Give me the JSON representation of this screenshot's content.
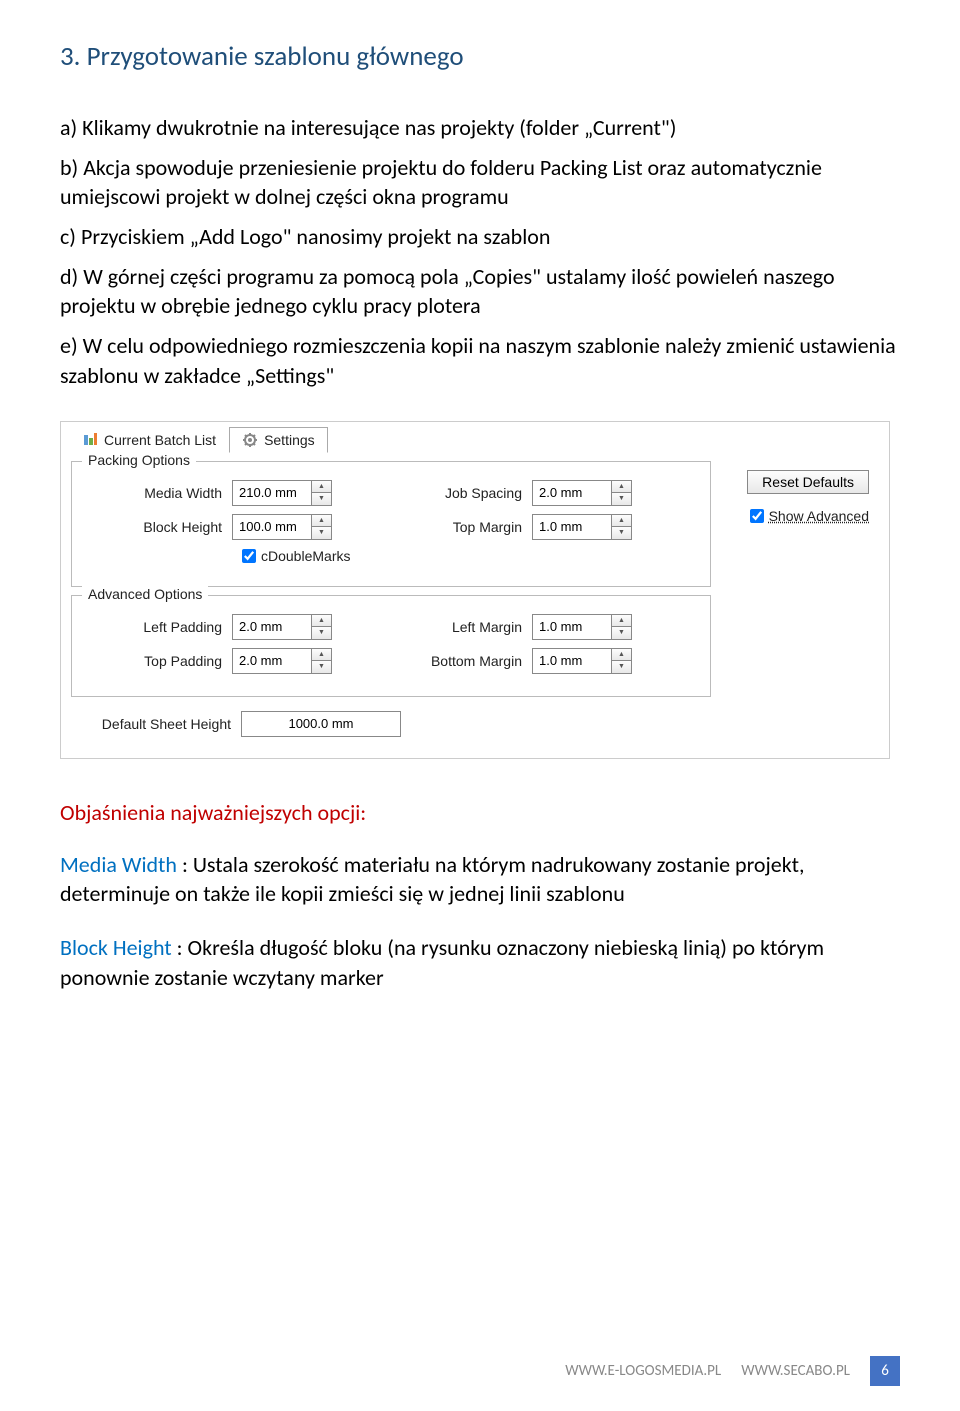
{
  "heading": "3. Przygotowanie szablonu głównego",
  "body": {
    "a": "a) Klikamy dwukrotnie na interesujące nas projekty (folder „Current\")",
    "b": "b) Akcja spowoduje przeniesienie projektu do folderu Packing List oraz automatycznie umiejscowi projekt w dolnej części okna programu",
    "c": "c) Przyciskiem „Add Logo\" nanosimy projekt na szablon",
    "d": "d) W górnej części programu za pomocą pola „Copies\" ustalamy ilość powieleń naszego projektu w obrębie jednego cyklu pracy plotera",
    "e": "e) W celu odpowiedniego rozmieszczenia kopii na naszym szablonie należy zmienić ustawienia szablonu w zakładce „Settings\""
  },
  "tabs": {
    "current": "Current Batch List",
    "settings": "Settings"
  },
  "packing": {
    "legend": "Packing Options",
    "mediaWidthLabel": "Media Width",
    "mediaWidthValue": "210.0 mm",
    "blockHeightLabel": "Block Height",
    "blockHeightValue": "100.0 mm",
    "jobSpacingLabel": "Job Spacing",
    "jobSpacingValue": "2.0 mm",
    "topMarginLabel": "Top Margin",
    "topMarginValue": "1.0 mm",
    "doubleMarks": "cDoubleMarks"
  },
  "advanced": {
    "legend": "Advanced Options",
    "leftPaddingLabel": "Left Padding",
    "leftPaddingValue": "2.0 mm",
    "topPaddingLabel": "Top Padding",
    "topPaddingValue": "2.0 mm",
    "leftMarginLabel": "Left Margin",
    "leftMarginValue": "1.0 mm",
    "bottomMarginLabel": "Bottom Margin",
    "bottomMarginValue": "1.0 mm"
  },
  "sheet": {
    "label": "Default Sheet Height",
    "value": "1000.0 mm"
  },
  "side": {
    "reset": "Reset Defaults",
    "showAdvanced": "Show Advanced"
  },
  "explain": {
    "heading": "Objaśnienia najważniejszych opcji:",
    "mediaWidthTerm": "Media Width",
    "mediaWidthText": " : Ustala szerokość materiału na którym nadrukowany zostanie projekt, determinuje on także ile kopii zmieści się w jednej linii szablonu",
    "blockHeightTerm": "Block Height",
    "blockHeightText": " : Określa długość bloku (na rysunku oznaczony niebieską linią) po którym ponownie zostanie wczytany marker"
  },
  "footer": {
    "url1": "WWW.E-LOGOSMEDIA.PL",
    "url2": "WWW.SECABO.PL",
    "page": "6"
  }
}
